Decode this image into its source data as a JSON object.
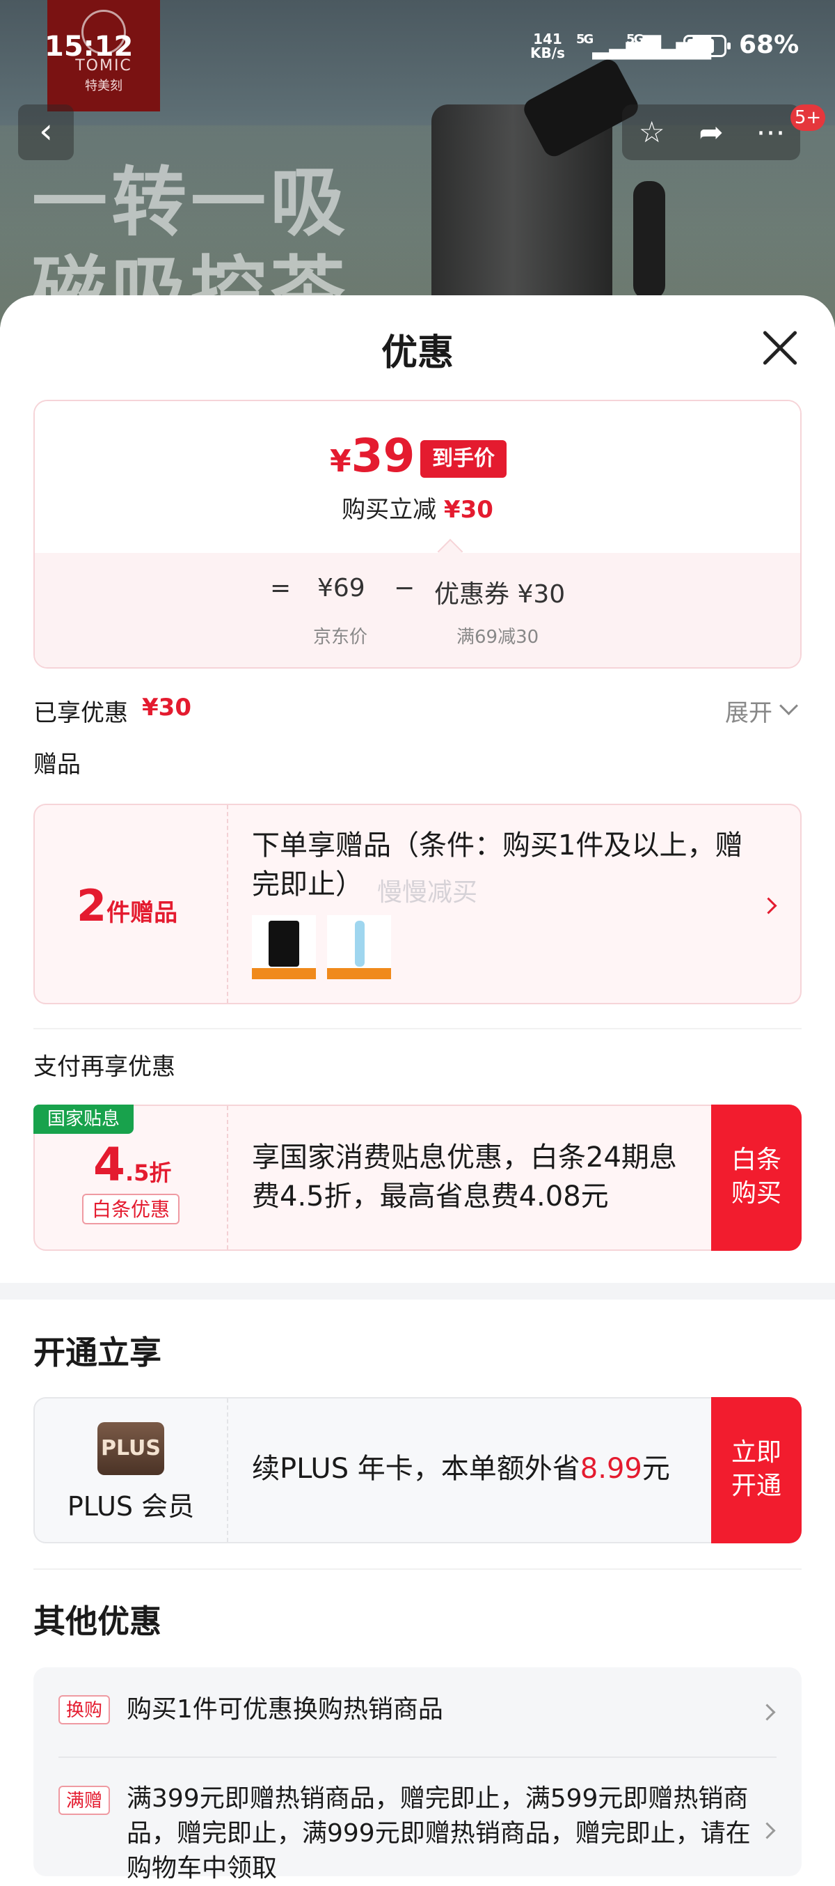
{
  "status_bar": {
    "time": "15:12",
    "net_speed_top": "141",
    "net_speed_bottom": "KB/s",
    "sig1": "5G",
    "sig2": "5G",
    "battery_percent": "68%",
    "battery_level": 0.68
  },
  "hero": {
    "logo_en": "TOMIC",
    "logo_cn": "特美刻",
    "slogan_line1": "一转一吸",
    "slogan_line2": "磁吸控茶",
    "badge": "5+"
  },
  "icons": {
    "back": "chevron-left-icon",
    "favorite": "star-icon",
    "share": "share-icon",
    "more": "more-icon",
    "close": "close-icon"
  },
  "sheet": {
    "title": "优惠"
  },
  "price": {
    "currency": "¥",
    "final_price": "39",
    "final_tag": "到手价",
    "reduce_label": "购买立减",
    "reduce_amount": "¥30",
    "eq": "=",
    "jd_price": "¥69",
    "minus": "−",
    "coupon": "优惠券 ¥30",
    "jd_price_label": "京东价",
    "coupon_rule": "满69减30"
  },
  "enjoyed": {
    "label": "已享优惠",
    "amount": "¥30",
    "expand": "展开"
  },
  "gift": {
    "section_label": "赠品",
    "count": "2",
    "count_suffix": "件赠品",
    "text": "下单享赠品（条件：购买1件及以上，赠完即止）",
    "watermark": "慢慢减买"
  },
  "pay": {
    "section_label": "支付再享优惠",
    "gov_badge": "国家贴息",
    "discount_big": "4",
    "discount_small": ".5折",
    "tag": "白条优惠",
    "text": "享国家消费贴息优惠，白条24期息费4.5折，最高省息费4.08元",
    "button_line1": "白条",
    "button_line2": "购买"
  },
  "plus": {
    "heading": "开通立享",
    "logo": "PLUS",
    "name": "PLUS 会员",
    "text_before": "续PLUS 年卡，本单额外省",
    "amount": "8.99",
    "text_after": "元",
    "button_line1": "立即",
    "button_line2": "开通"
  },
  "other": {
    "heading": "其他优惠",
    "items": [
      {
        "tag": "换购",
        "text": "购买1件可优惠换购热销商品"
      },
      {
        "tag": "满赠",
        "text": "满399元即赠热销商品，赠完即止，满599元即赠热销商品，赠完即止，满999元即赠热销商品，赠完即止，请在购物车中领取"
      }
    ]
  }
}
